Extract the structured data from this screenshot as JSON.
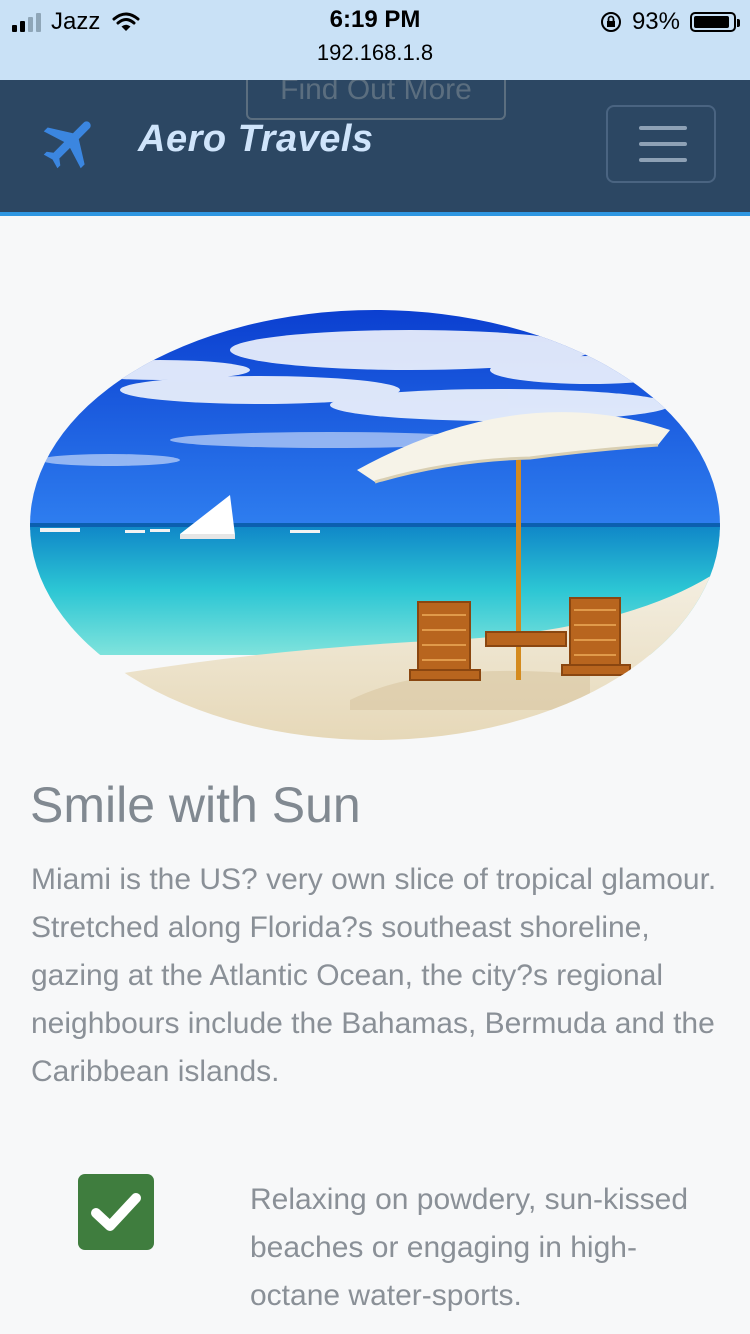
{
  "status": {
    "carrier": "Jazz",
    "time": "6:19 PM",
    "url": "192.168.1.8",
    "battery": "93%",
    "battery_level": 0.93
  },
  "nav": {
    "ghost_button": "Find Out More",
    "brand": "Aero Travels",
    "icons": {
      "brand": "airplane-icon",
      "menu": "hamburger-icon"
    }
  },
  "content": {
    "title": "Smile with Sun",
    "description": "Miami is the US? very own slice of tropical glamour. Stretched along Florida?s southeast shoreline, gazing at the Atlantic Ocean, the city?s regional neighbours include the Bahamas, Bermuda and the Caribbean islands.",
    "feature": "Relaxing on powdery, sun-kissed beaches or engaging in high-octane water-sports.",
    "feature_icon": "check-icon"
  },
  "colors": {
    "status_bg": "#c9e1f6",
    "nav_bg": "#2c4763",
    "accent": "#2f97e2",
    "check_bg": "#3f7d3e"
  }
}
